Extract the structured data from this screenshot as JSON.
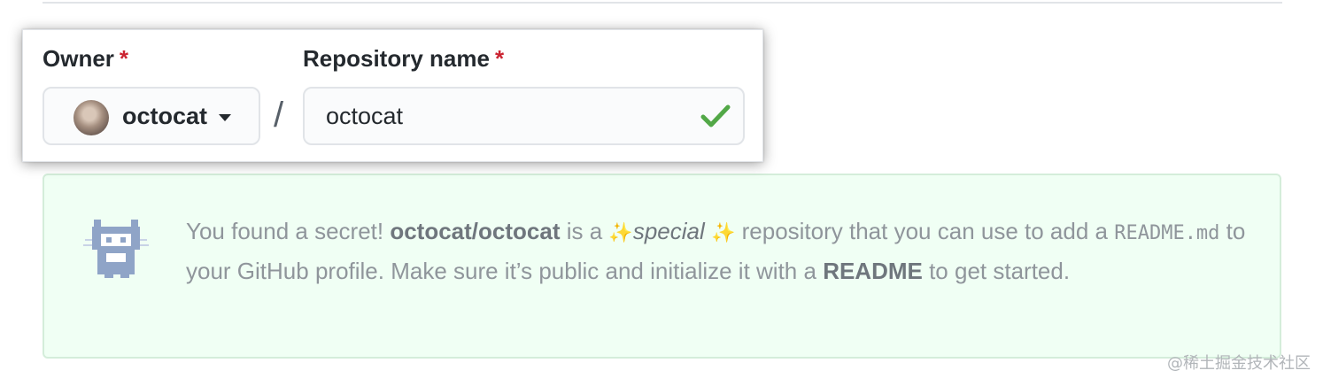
{
  "form": {
    "owner_label": "Owner",
    "required_marker": "*",
    "owner_value": "octocat",
    "separator": "/",
    "repo_label": "Repository name",
    "repo_value": "octocat",
    "avatar_icon": "user-avatar",
    "caret_icon": "caret-down-icon",
    "valid_icon": "check-icon",
    "valid_color": "#52a847"
  },
  "notice": {
    "icon": "mona-cat-icon",
    "text_1": "You found a secret! ",
    "repo_ref": "octocat/octocat",
    "text_2": " is a ",
    "sparkle": "✨",
    "special": "special",
    "text_3": " repository that you can use to add a ",
    "readme_file": "README.md",
    "text_4": " to your GitHub profile. Make sure it’s public and initialize it with a ",
    "readme_word": "README",
    "text_5": " to get started.",
    "background_color": "#f0fff4"
  },
  "watermark": "@稀土掘金技术社区"
}
